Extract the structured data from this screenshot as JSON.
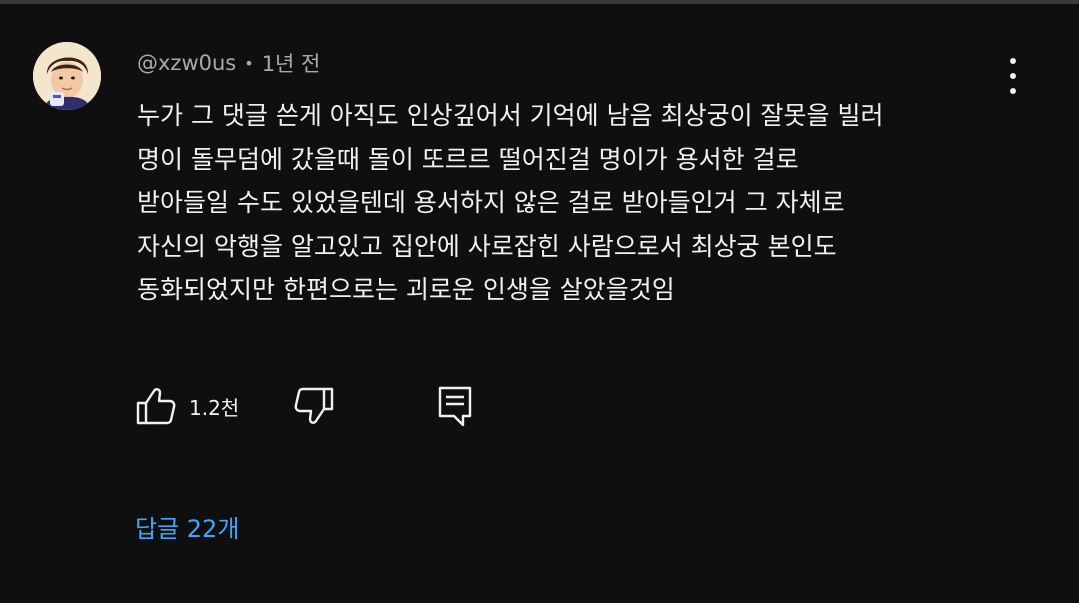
{
  "comment": {
    "author": "@xzw0us",
    "time": "1년 전",
    "text_lines": [
      "누가 그 댓글 쓴게 아직도 인상깊어서 기억에 남음 최상궁이 잘못을 빌러",
      "명이 돌무덤에 갔을때 돌이 또르르 떨어진걸 명이가 용서한 걸로",
      "받아들일 수도 있었을텐데 용서하지 않은 걸로 받아들인거 그 자체로",
      "자신의 악행을 알고있고 집안에 사로잡힌 사람으로서 최상궁 본인도",
      "동화되었지만 한편으로는 괴로운 인생을 살았을것임"
    ],
    "like_count": "1.2천",
    "replies_label": "답글 22개"
  },
  "icons": {
    "like": "thumbs-up-icon",
    "dislike": "thumbs-down-icon",
    "reply": "comment-reply-icon",
    "menu": "more-vert-icon"
  },
  "colors": {
    "background": "#0f0f0f",
    "text": "#f1f1f1",
    "meta": "#aaaaaa",
    "link": "#3ea6ff"
  }
}
